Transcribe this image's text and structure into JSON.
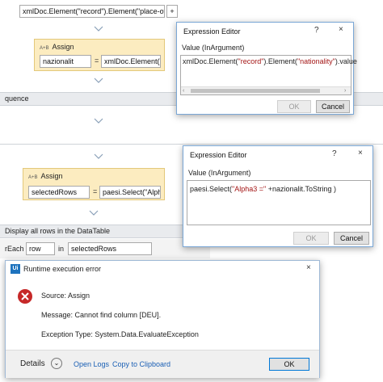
{
  "top_field_text": "xmlDoc.Element(\"record\").Element(\"place-of-birth\")",
  "top_field_button": "+",
  "assign1": {
    "title_icon": "A+B",
    "title": "Assign",
    "to_value": "nazionalit",
    "equals": "=",
    "value": "xmlDoc.Element(\"r"
  },
  "sequence_bar_label": "quence",
  "assign2": {
    "title_icon": "A+B",
    "title": "Assign",
    "to_value": "selectedRows",
    "equals": "=",
    "value": "paesi.Select(\"Alpha"
  },
  "datatable_bar_label": "Display all rows in the DataTable",
  "foreach": {
    "label": "rEach",
    "item": "row",
    "in_label": "in",
    "collection": "selectedRows"
  },
  "expr_editor_1": {
    "title": "Expression Editor",
    "help": "?",
    "close": "×",
    "label": "Value (InArgument)",
    "expression_parts": [
      "xmlDoc.Element(",
      "\"record\"",
      ").Element(",
      "\"nationality\"",
      ").value"
    ],
    "ok": "OK",
    "cancel": "Cancel"
  },
  "expr_editor_2": {
    "title": "Expression Editor",
    "help": "?",
    "close": "×",
    "label": "Value (InArgument)",
    "expression_parts": [
      "paesi.Select(",
      "\"Alpha3 =\"",
      " +nazionalit.ToString )"
    ],
    "ok": "OK",
    "cancel": "Cancel"
  },
  "error_dialog": {
    "app_badge": "Ui",
    "title": "Runtime execution error",
    "close": "×",
    "source": "Source: Assign",
    "message": "Message: Cannot find column [DEU].",
    "exception": "Exception Type: System.Data.EvaluateException",
    "details": "Details",
    "open_logs": "Open Logs",
    "copy": "Copy to Clipboard",
    "ok": "OK"
  },
  "colors": {
    "activity_bg": "#fcecc0",
    "dialog_border": "#7aa7d6",
    "error_red": "#c62828",
    "link_blue": "#1a5fb4",
    "ui_badge_blue": "#1e73be"
  }
}
